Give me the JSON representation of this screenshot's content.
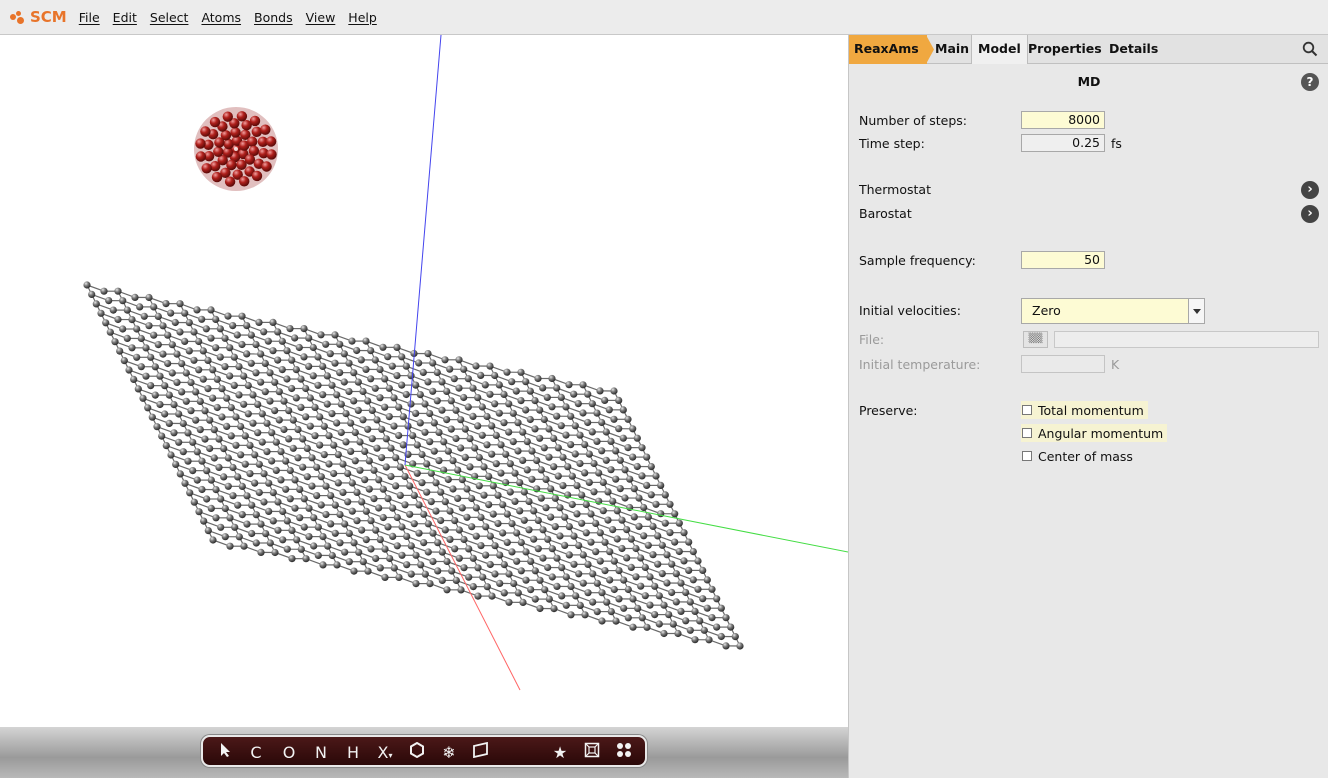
{
  "app": {
    "logo_text": "SCM"
  },
  "menu": [
    "File",
    "Edit",
    "Select",
    "Atoms",
    "Bonds",
    "View",
    "Help"
  ],
  "toolbar": {
    "tools": [
      {
        "name": "select-tool",
        "glyph": "pointer-icon"
      },
      {
        "name": "carbon-tool",
        "label": "C"
      },
      {
        "name": "oxygen-tool",
        "label": "O"
      },
      {
        "name": "nitrogen-tool",
        "label": "N"
      },
      {
        "name": "hydrogen-tool",
        "label": "H"
      },
      {
        "name": "other-element-tool",
        "label": "X"
      },
      {
        "name": "ring-tool",
        "glyph": "hexagon-icon"
      },
      {
        "name": "freeze-tool",
        "glyph": "snowflake-icon"
      },
      {
        "name": "slab-tool",
        "glyph": "plane-icon"
      },
      {
        "name": "favorites-tool",
        "glyph": "star-icon"
      },
      {
        "name": "crystal-tool",
        "glyph": "cube-icon"
      },
      {
        "name": "molecules-tool",
        "glyph": "dots-icon"
      }
    ]
  },
  "panel": {
    "tabs": [
      "ReaxAms",
      "Main",
      "Model",
      "Properties",
      "Details"
    ],
    "active_tab": "Model",
    "section_title": "MD",
    "fields": {
      "steps_label": "Number of steps:",
      "steps_value": "8000",
      "timestep_label": "Time step:",
      "timestep_value": "0.25",
      "timestep_unit": "fs",
      "thermostat_label": "Thermostat",
      "barostat_label": "Barostat",
      "sample_label": "Sample frequency:",
      "sample_value": "50",
      "velocities_label": "Initial velocities:",
      "velocities_value": "Zero",
      "file_label": "File:",
      "temp_label": "Initial temperature:",
      "temp_unit": "K",
      "preserve_label": "Preserve:",
      "preserve_total": "Total momentum",
      "preserve_angular": "Angular momentum",
      "preserve_center": "Center of mass"
    },
    "checkboxes": {
      "total": false,
      "angular": false,
      "center": false
    }
  },
  "viewport": {
    "atom_color_carbon": "#5a5a5a",
    "atom_color_oxygen": "#b0201c",
    "axis_colors": {
      "x": "#ff6666",
      "y": "#44dd44",
      "z": "#4444ee"
    }
  }
}
